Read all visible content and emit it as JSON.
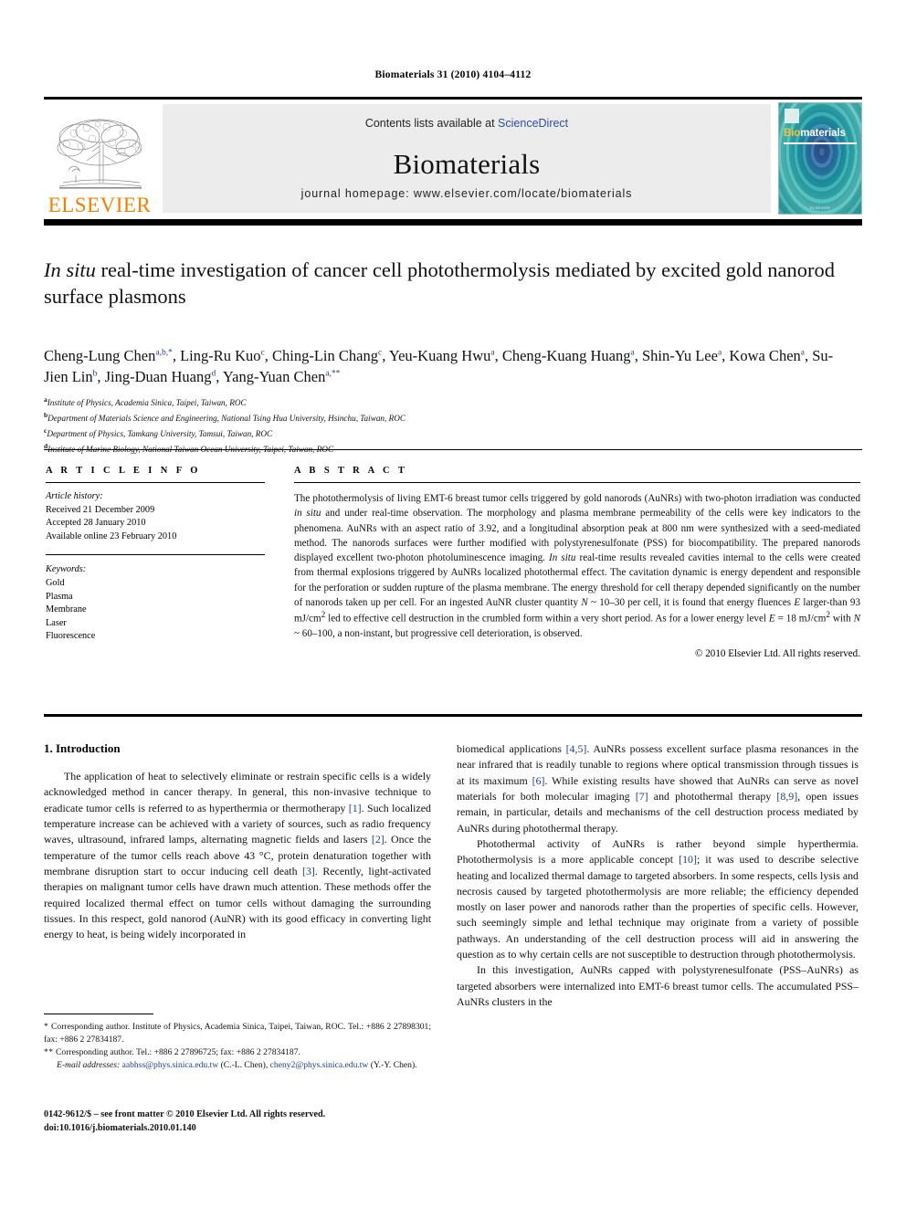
{
  "running_head": "Biomaterials 31 (2010) 4104–4112",
  "masthead": {
    "publisher_name": "ELSEVIER",
    "contents_prefix": "Contents lists available at ",
    "contents_link": "ScienceDirect",
    "journal_title": "Biomaterials",
    "homepage": "journal homepage: www.elsevier.com/locate/biomaterials",
    "cover_word_bio": "Bio",
    "cover_word_rest": "materials",
    "cover_footer": "ELSEVIER",
    "link_color": "#2a4ea2",
    "elsevier_orange": "#F08000"
  },
  "article": {
    "title_italic": "In situ",
    "title_rest": " real-time investigation of cancer cell photothermolysis mediated by excited gold nanorod surface plasmons",
    "authors": [
      {
        "name": "Cheng-Lung Chen",
        "sup": "a,b,*"
      },
      {
        "name": "Ling-Ru Kuo",
        "sup": "c"
      },
      {
        "name": "Ching-Lin Chang",
        "sup": "c"
      },
      {
        "name": "Yeu-Kuang Hwu",
        "sup": "a"
      },
      {
        "name": "Cheng-Kuang Huang",
        "sup": "a"
      },
      {
        "name": "Shin-Yu Lee",
        "sup": "a"
      },
      {
        "name": "Kowa Chen",
        "sup": "a"
      },
      {
        "name": "Su-Jien Lin",
        "sup": "b"
      },
      {
        "name": "Jing-Duan Huang",
        "sup": "d"
      },
      {
        "name": "Yang-Yuan Chen",
        "sup": "a,**"
      }
    ],
    "affiliations": [
      {
        "mark": "a",
        "text": "Institute of Physics, Academia Sinica, Taipei, Taiwan, ROC"
      },
      {
        "mark": "b",
        "text": "Department of Materials Science and Engineering, National Tsing Hua University, Hsinchu, Taiwan, ROC"
      },
      {
        "mark": "c",
        "text": "Department of Physics, Tamkang University, Tamsui, Taiwan, ROC"
      },
      {
        "mark": "d",
        "text": "Institute of Marine Biology, National Taiwan Ocean University, Taipei, Taiwan, ROC"
      }
    ]
  },
  "article_info": {
    "heading": "A R T I C L E  I N F O",
    "history_label": "Article history:",
    "history": [
      "Received 21 December 2009",
      "Accepted 28 January 2010",
      "Available online 23 February 2010"
    ],
    "keywords_label": "Keywords:",
    "keywords": [
      "Gold",
      "Plasma",
      "Membrane",
      "Laser",
      "Fluorescence"
    ]
  },
  "abstract": {
    "heading": "A B S T R A C T",
    "text_1": "The photothermolysis of living EMT-6 breast tumor cells triggered by gold nanorods (AuNRs) with two-photon irradiation was conducted ",
    "it_1": "in situ",
    "text_2": " and under real-time observation. The morphology and plasma membrane permeability of the cells were key indicators to the phenomena. AuNRs with an aspect ratio of 3.92, and a longitudinal absorption peak at 800 nm were synthesized with a seed-mediated method. The nanorods surfaces were further modified with polystyrenesulfonate (PSS) for biocompatibility. The prepared nanorods displayed excellent two-photon photoluminescence imaging. ",
    "it_2": "In situ",
    "text_3": " real-time results revealed cavities internal to the cells were created from thermal explosions triggered by AuNRs localized photothermal effect. The cavitation dynamic is energy dependent and responsible for the perforation or sudden rupture of the plasma membrane. The energy threshold for cell therapy depended significantly on the number of nanorods taken up per cell. For an ingested AuNR cluster quantity ",
    "it_3": "N",
    "text_4": " ~ 10–30 per cell, it is found that energy fluences ",
    "it_4": "E",
    "text_5": " larger-than 93 mJ/cm",
    "sup_5": "2",
    "text_6": " led to effective cell destruction in the crumbled form within a very short period. As for a lower energy level ",
    "it_6": "E",
    "text_7": " = 18 mJ/cm",
    "sup_7": "2",
    "text_8": " with ",
    "it_8": "N",
    "text_9": " ~ 60–100, a non-instant, but progressive cell deterioration, is observed.",
    "copyright": "© 2010 Elsevier Ltd. All rights reserved."
  },
  "body": {
    "section_title": "1. Introduction",
    "left_paragraphs": [
      {
        "parts": [
          {
            "t": "The application of heat to selectively eliminate or restrain specific cells is a widely acknowledged method in cancer therapy. In general, this non-invasive technique to eradicate tumor cells is referred to as hyperthermia or thermotherapy "
          },
          {
            "ref": "[1]"
          },
          {
            "t": ". Such localized temperature increase can be achieved with a variety of sources, such as radio frequency waves, ultrasound, infrared lamps, alternating magnetic fields and lasers "
          },
          {
            "ref": "[2]"
          },
          {
            "t": ". Once the temperature of the tumor cells reach above 43 °C, protein denaturation together with membrane disruption start to occur inducing cell death "
          },
          {
            "ref": "[3]"
          },
          {
            "t": ". Recently, light-activated therapies on malignant tumor cells have drawn much attention. These methods offer the required localized thermal effect on tumor cells without damaging the surrounding tissues. In this respect, gold nanorod (AuNR) with its good efficacy in converting light energy to heat, is being widely incorporated in"
          }
        ]
      }
    ],
    "right_paragraphs": [
      {
        "indent": false,
        "parts": [
          {
            "t": "biomedical applications "
          },
          {
            "ref": "[4,5]"
          },
          {
            "t": ". AuNRs possess excellent surface plasma resonances in the near infrared that is readily tunable to regions where optical transmission through tissues is at its maximum "
          },
          {
            "ref": "[6]"
          },
          {
            "t": ". While existing results have showed that AuNRs can serve as novel materials for both molecular imaging "
          },
          {
            "ref": "[7]"
          },
          {
            "t": " and photothermal therapy "
          },
          {
            "ref": "[8,9]"
          },
          {
            "t": ", open issues remain, in particular, details and mechanisms of the cell destruction process mediated by AuNRs during photothermal therapy."
          }
        ]
      },
      {
        "indent": true,
        "parts": [
          {
            "t": "Photothermal activity of AuNRs is rather beyond simple hyperthermia. Photothermolysis is a more applicable concept "
          },
          {
            "ref": "[10]"
          },
          {
            "t": "; it was used to describe selective heating and localized thermal damage to targeted absorbers. In some respects, cells lysis and necrosis caused by targeted photothermolysis are more reliable; the efficiency depended mostly on laser power and nanorods rather than the properties of specific cells. However, such seemingly simple and lethal technique may originate from a variety of possible pathways. An understanding of the cell destruction process will aid in answering the question as to why certain cells are not susceptible to destruction through photothermolysis."
          }
        ]
      },
      {
        "indent": true,
        "parts": [
          {
            "t": "In this investigation, AuNRs capped with polystyrenesulfonate (PSS–AuNRs) as targeted absorbers were internalized into EMT-6 breast tumor cells. The accumulated PSS–AuNRs clusters in the"
          }
        ]
      }
    ]
  },
  "footnotes": {
    "fn1_mark": "*",
    "fn1": " Corresponding author. Institute of Physics, Academia Sinica, Taipei, Taiwan, ROC. Tel.: +886 2 27898301; fax: +886 2 27834187.",
    "fn2_mark": "**",
    "fn2": " Corresponding author. Tel.: +886 2 27896725; fax: +886 2 27834187.",
    "email_label": "E-mail addresses:",
    "email_1": "aabhss@phys.sinica.edu.tw",
    "email_1_owner": " (C.-L. Chen), ",
    "email_2": "cheny2@phys.sinica.edu.tw",
    "email_2_owner": " (Y.-Y. Chen)."
  },
  "imprint": {
    "line1": "0142-9612/$ – see front matter © 2010 Elsevier Ltd. All rights reserved.",
    "line2": "doi:10.1016/j.biomaterials.2010.01.140"
  }
}
